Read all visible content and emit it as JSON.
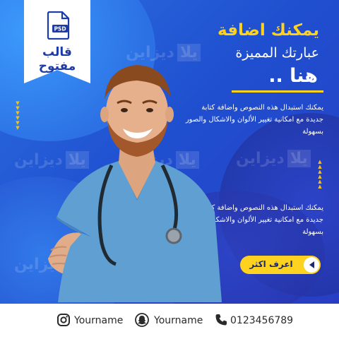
{
  "ribbon": {
    "icon": "psd-file-icon",
    "icon_text": "PSD",
    "line1": "قالب",
    "line2": "مفتوح"
  },
  "headline": {
    "line1": "يمكنك اضافة",
    "line2": "عبارتك المميزة",
    "line3": "هنا .."
  },
  "paragraphs": [
    "يمكنك استبدال هذه النصوص واضافة كتابة جديدة مع امكانية تغيير الألوان والاشكال والصور بسهولة",
    "يمكنك استبدال هذه النصوص واضافة كتابة جديدة مع امكانية تغيير الألوان والاشكال والصور بسهولة"
  ],
  "watermark": {
    "word": "ديزاين",
    "badge": "يلا"
  },
  "cta": {
    "label": "اعرف اكثر",
    "icon": "play-left-icon"
  },
  "footer": {
    "instagram": "Yourname",
    "snapchat": "Yourname",
    "phone": "0123456789"
  },
  "colors": {
    "accent": "#ffd21f",
    "background": "#2354d6",
    "ribbon_text": "#1c3aa8"
  }
}
